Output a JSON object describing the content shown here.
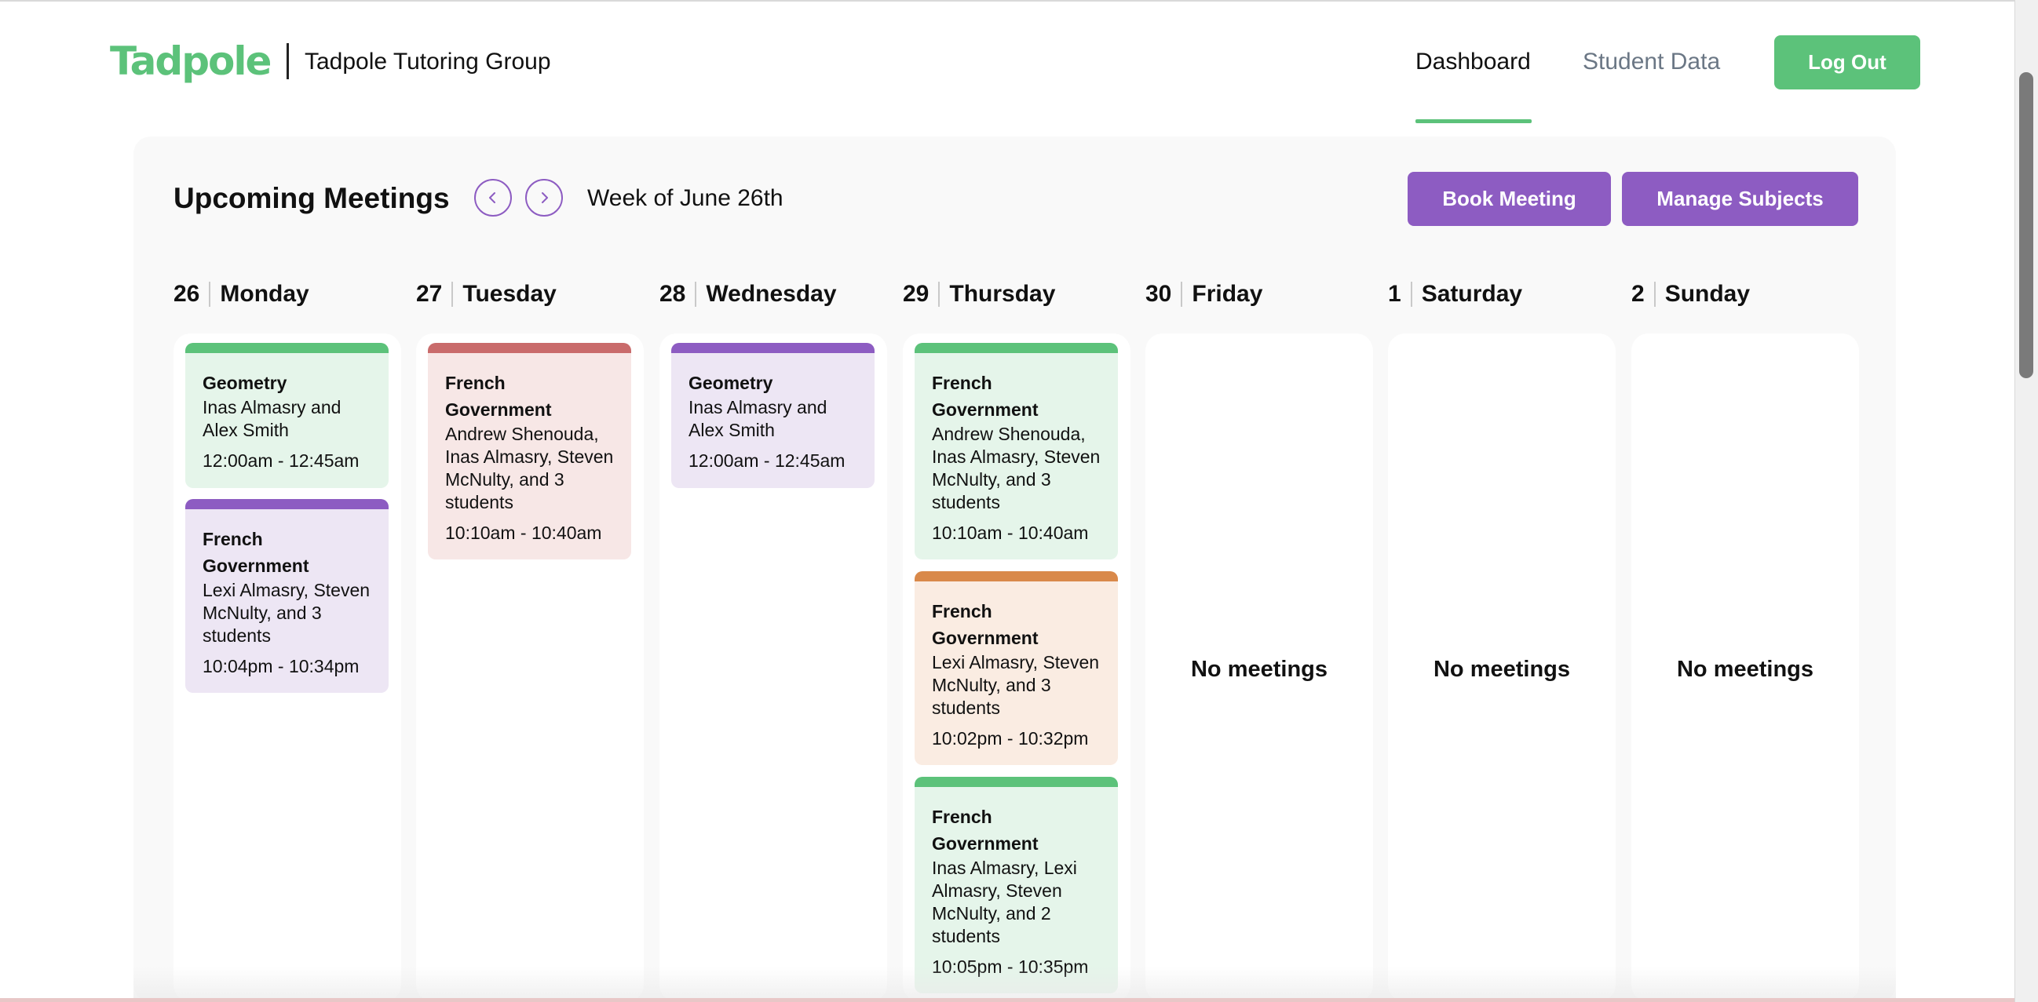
{
  "header": {
    "logo_text": "Tadpole",
    "brand": "Tadpole Tutoring Group",
    "nav": {
      "dashboard": "Dashboard",
      "student_data": "Student Data"
    },
    "logout": "Log Out"
  },
  "meetings": {
    "title": "Upcoming Meetings",
    "week_label": "Week of June 26th",
    "book_button": "Book Meeting",
    "manage_button": "Manage Subjects",
    "empty_text": "No meetings"
  },
  "days": [
    {
      "num": "26",
      "name": "Monday"
    },
    {
      "num": "27",
      "name": "Tuesday"
    },
    {
      "num": "28",
      "name": "Wednesday"
    },
    {
      "num": "29",
      "name": "Thursday"
    },
    {
      "num": "30",
      "name": "Friday"
    },
    {
      "num": "1",
      "name": "Saturday"
    },
    {
      "num": "2",
      "name": "Sunday"
    }
  ],
  "cards": {
    "mon1": {
      "subject": "Geometry",
      "people": "Inas Almasry and Alex Smith",
      "time": "12:00am - 12:45am",
      "color": "#5cc27a"
    },
    "mon2": {
      "subject": "French Government",
      "people": "Lexi Almasry, Steven McNulty, and 3 students",
      "time": "10:04pm - 10:34pm",
      "color": "#8d5cc2"
    },
    "tue1": {
      "subject": "French Government",
      "people": "Andrew Shenouda, Inas Almasry, Steven McNulty, and 3 students",
      "time": "10:10am - 10:40am",
      "color": "#c96b6b"
    },
    "wed1": {
      "subject": "Geometry",
      "people": "Inas Almasry and Alex Smith",
      "time": "12:00am - 12:45am",
      "color": "#8d5cc2"
    },
    "thu1": {
      "subject": "French Government",
      "people": "Andrew Shenouda, Inas Almasry, Steven McNulty, and 3 students",
      "time": "10:10am - 10:40am",
      "color": "#5cc27a"
    },
    "thu2": {
      "subject": "French Government",
      "people": "Lexi Almasry, Steven McNulty, and 3 students",
      "time": "10:02pm - 10:32pm",
      "color": "#d9894a"
    },
    "thu3": {
      "subject": "French Government",
      "people": "Inas Almasry, Lexi Almasry, Steven McNulty, and 2 students",
      "time": "10:05pm - 10:35pm",
      "color": "#5cc27a"
    }
  },
  "icons": {
    "prev": "chevron-left-icon",
    "next": "chevron-right-icon"
  },
  "colors": {
    "brand_green": "#5cc27a",
    "accent_purple": "#8d5cc2",
    "red": "#c96b6b",
    "orange": "#d9894a"
  }
}
